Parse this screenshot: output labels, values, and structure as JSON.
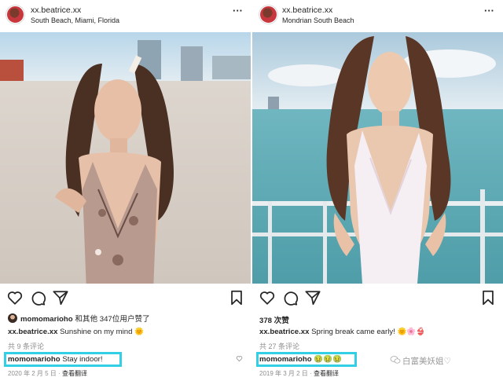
{
  "left_post": {
    "username": "xx.beatrice.xx",
    "location": "South Beach, Miami, Florida",
    "liked_by_user": "momomarioho",
    "liked_by_rest": "和其他 347位用户赞了",
    "caption_user": "xx.beatrice.xx",
    "caption_text": "Sunshine on my mind 🌞",
    "comments_count": "共 9 条评论",
    "highlight_user": "momomarioho",
    "highlight_text": "Stay indoor!",
    "date": "2020 年 2 月 5 日",
    "translate": "查看翻译"
  },
  "right_post": {
    "username": "xx.beatrice.xx",
    "location": "Mondrian South Beach",
    "likes": "378 次赞",
    "caption_user": "xx.beatrice.xx",
    "caption_text": "Spring break came early! 🌞🌸👙",
    "comments_count": "共 27 条评论",
    "highlight_user": "momomarioho",
    "highlight_text": "🤢🤢🤢",
    "date": "2019 年 3 月 2 日",
    "translate": "查看翻译"
  },
  "watermark": "白富美妖姐♡",
  "separator": "·",
  "icons": [
    "more-horizontal-icon",
    "heart-icon",
    "comment-icon",
    "share-icon",
    "bookmark-icon",
    "wechat-watermark-icon"
  ],
  "colors": {
    "highlight": "#33d0e5",
    "text": "#262626",
    "muted": "#8e8e8e"
  }
}
